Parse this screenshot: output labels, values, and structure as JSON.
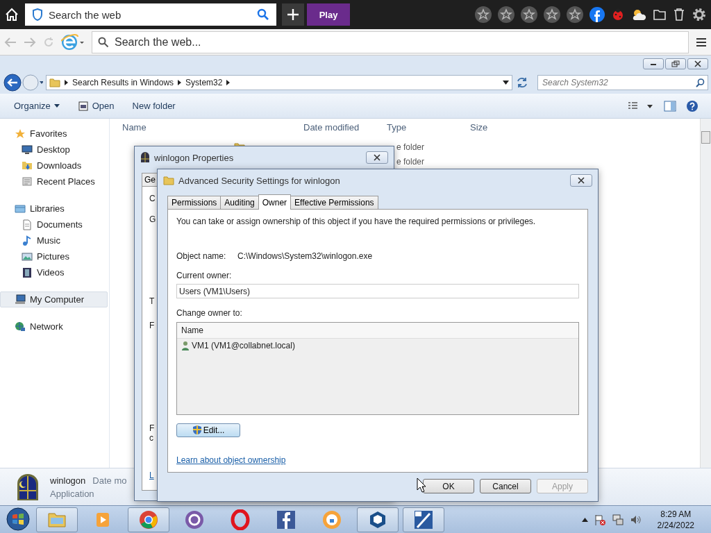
{
  "browser_toolbar": {
    "search": {
      "placeholder": "Search the web"
    },
    "play_button": "Play"
  },
  "address_bar": {
    "search": {
      "placeholder": "Search the web..."
    }
  },
  "explorer": {
    "breadcrumb": [
      "Search Results in Windows",
      "System32"
    ],
    "search": {
      "placeholder": "Search System32"
    },
    "toolbar": [
      {
        "label": "Organize",
        "kind": "menu"
      },
      {
        "label": "Open",
        "kind": "icon"
      },
      {
        "label": "New folder",
        "kind": "plain"
      }
    ],
    "sidebar": {
      "items": [
        {
          "label": "Favorites",
          "kind": "star",
          "selected": false,
          "children": [
            {
              "label": "Desktop",
              "kind": "desktop",
              "selected": false
            },
            {
              "label": "Downloads",
              "kind": "downloads",
              "selected": false
            },
            {
              "label": "Recent Places",
              "kind": "recent",
              "selected": false
            }
          ]
        },
        {
          "label": "Libraries",
          "kind": "library",
          "selected": false,
          "children": [
            {
              "label": "Documents",
              "kind": "document",
              "selected": false
            },
            {
              "label": "Music",
              "kind": "music",
              "selected": false
            },
            {
              "label": "Pictures",
              "kind": "picture",
              "selected": false
            },
            {
              "label": "Videos",
              "kind": "video",
              "selected": false
            }
          ]
        },
        {
          "label": "My Computer",
          "kind": "computer",
          "selected": true
        },
        {
          "label": "Network",
          "kind": "network",
          "selected": false
        }
      ]
    },
    "file_list": {
      "columns": [
        "Name",
        "Date modified",
        "Type",
        "Size"
      ],
      "rows": [
        {
          "type": "e folder"
        },
        {
          "type": "e folder"
        }
      ]
    },
    "details": {
      "name": "winlogon",
      "kind_label": "Application",
      "field_label": "Date mo"
    }
  },
  "properties_dialog": {
    "title": "winlogon Properties",
    "tab": "Ge",
    "fragments": [
      {
        "text": "C",
        "kind": "text"
      },
      {
        "text": "G",
        "kind": "text"
      },
      {
        "text": "T",
        "kind": "text"
      },
      {
        "text": "F",
        "kind": "text"
      },
      {
        "text": "F",
        "kind": "text"
      },
      {
        "text": "c",
        "kind": "text"
      },
      {
        "text": "L",
        "kind": "link"
      }
    ]
  },
  "advanced_dialog": {
    "title": "Advanced Security Settings for winlogon",
    "tabs": [
      {
        "label": "Permissions",
        "selected": false
      },
      {
        "label": "Auditing",
        "selected": false
      },
      {
        "label": "Owner",
        "selected": true
      },
      {
        "label": "Effective Permissions",
        "selected": false
      }
    ],
    "intro": "You can take or assign ownership of this object if you have the required permissions or privileges.",
    "object_name_label": "Object name:",
    "object_name": "C:\\Windows\\System32\\winlogon.exe",
    "current_owner_label": "Current owner:",
    "current_owner": "Users (VM1\\Users)",
    "change_owner_label": "Change owner to:",
    "owner_list": {
      "column": "Name",
      "rows": [
        {
          "name": "VM1 (VM1@collabnet.local)"
        }
      ]
    },
    "edit_button": "Edit...",
    "link": "Learn about object ownership",
    "buttons": [
      {
        "label": "OK",
        "disabled": false
      },
      {
        "label": "Cancel",
        "disabled": false
      },
      {
        "label": "Apply",
        "disabled": true
      }
    ]
  },
  "taskbar": {
    "apps": [
      {
        "kind": "explorer",
        "running": true
      },
      {
        "kind": "media",
        "running": false
      },
      {
        "kind": "chrome",
        "running": true
      },
      {
        "kind": "ring",
        "running": false
      },
      {
        "kind": "opera",
        "running": false
      },
      {
        "kind": "facebook",
        "running": false
      },
      {
        "kind": "lock",
        "running": false
      },
      {
        "kind": "cube",
        "running": true
      },
      {
        "kind": "xp",
        "running": true
      }
    ],
    "clock": {
      "time": "8:29 AM",
      "date": "2/24/2022"
    }
  }
}
